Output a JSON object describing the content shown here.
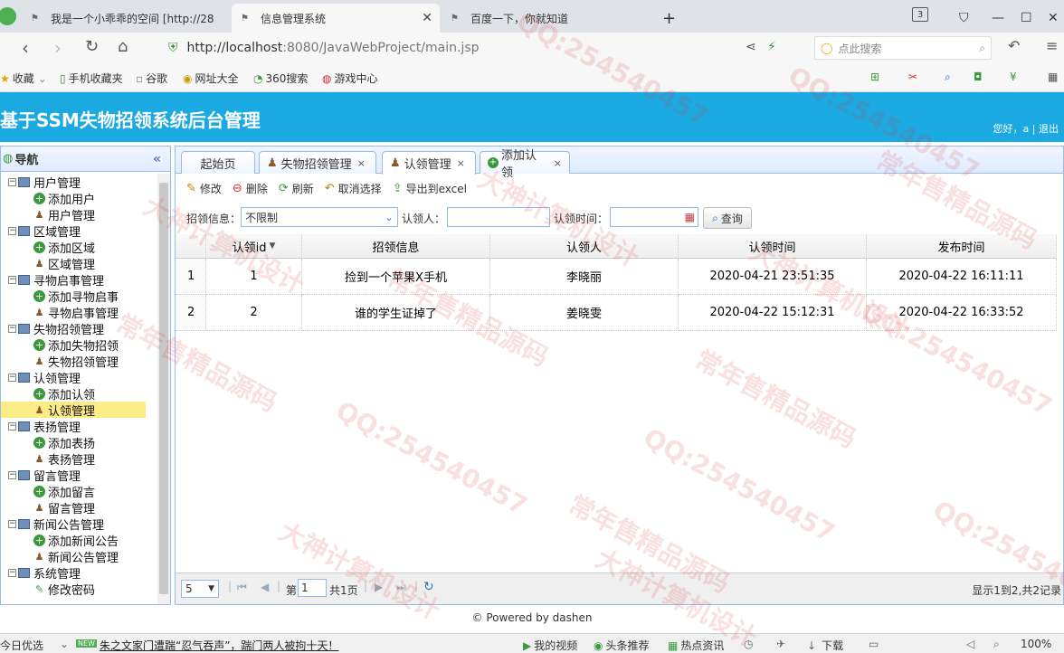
{
  "browser": {
    "tabs": [
      {
        "title": "我是一个小乖乖的空间 [http://28"
      },
      {
        "title": "信息管理系统"
      },
      {
        "title": "百度一下，你就知道"
      }
    ],
    "tab_count_badge": "3",
    "url_host": "http://localhost",
    "url_rest": ":8080/JavaWebProject/main.jsp",
    "search_placeholder": "点此搜索",
    "bookmarks": [
      "收藏",
      "手机收藏夹",
      "谷歌",
      "网址大全",
      "360搜索",
      "游戏中心"
    ]
  },
  "app": {
    "title": "基于SSM失物招领系统后台管理",
    "greeting": "您好，a",
    "logout": "退出"
  },
  "sidebar": {
    "title": "导航",
    "groups": [
      {
        "label": "用户管理",
        "items": [
          "添加用户",
          "用户管理"
        ]
      },
      {
        "label": "区域管理",
        "items": [
          "添加区域",
          "区域管理"
        ]
      },
      {
        "label": "寻物启事管理",
        "items": [
          "添加寻物启事",
          "寻物启事管理"
        ]
      },
      {
        "label": "失物招领管理",
        "items": [
          "添加失物招领",
          "失物招领管理"
        ]
      },
      {
        "label": "认领管理",
        "items": [
          "添加认领",
          "认领管理"
        ]
      },
      {
        "label": "表扬管理",
        "items": [
          "添加表扬",
          "表扬管理"
        ]
      },
      {
        "label": "留言管理",
        "items": [
          "添加留言",
          "留言管理"
        ]
      },
      {
        "label": "新闻公告管理",
        "items": [
          "添加新闻公告",
          "新闻公告管理"
        ]
      },
      {
        "label": "系统管理",
        "items": [
          "修改密码"
        ]
      }
    ],
    "selected": "认领管理"
  },
  "tabs": [
    "起始页",
    "失物招领管理",
    "认领管理",
    "添加认领"
  ],
  "toolbar": {
    "edit": "修改",
    "delete": "删除",
    "refresh": "刷新",
    "cancel_select": "取消选择",
    "export": "导出到excel"
  },
  "filters": {
    "lost_label": "招领信息：",
    "lost_value": "不限制",
    "person_label": "认领人：",
    "time_label": "认领时间：",
    "query": "查询"
  },
  "grid": {
    "columns": [
      "认领id",
      "招领信息",
      "认领人",
      "认领时间",
      "发布时间"
    ],
    "rows": [
      {
        "n": "1",
        "id": "1",
        "info": "捡到一个苹果X手机",
        "person": "李晓丽",
        "claim_time": "2020-04-21 23:51:35",
        "pub_time": "2020-04-22 16:11:11"
      },
      {
        "n": "2",
        "id": "2",
        "info": "谁的学生证掉了",
        "person": "姜晓雯",
        "claim_time": "2020-04-22 15:12:31",
        "pub_time": "2020-04-22 16:33:52"
      }
    ]
  },
  "pager": {
    "page_size": "5",
    "page_label": "第",
    "page_value": "1",
    "total_pages": "共1页",
    "summary": "显示1到2,共2记录"
  },
  "footer": "© Powered by dashen",
  "statusbar": {
    "left": "今日优选",
    "badge": "NEW",
    "news": "朱之文家门遭踹“忍气吞声”，踹门两人被拘十天！",
    "items": [
      "我的视频",
      "头条推荐",
      "热点资讯",
      "下载"
    ],
    "zoom": "100%"
  },
  "watermark": [
    "QQ:254540457",
    "大神计算机设计",
    "常年售精品源码"
  ]
}
